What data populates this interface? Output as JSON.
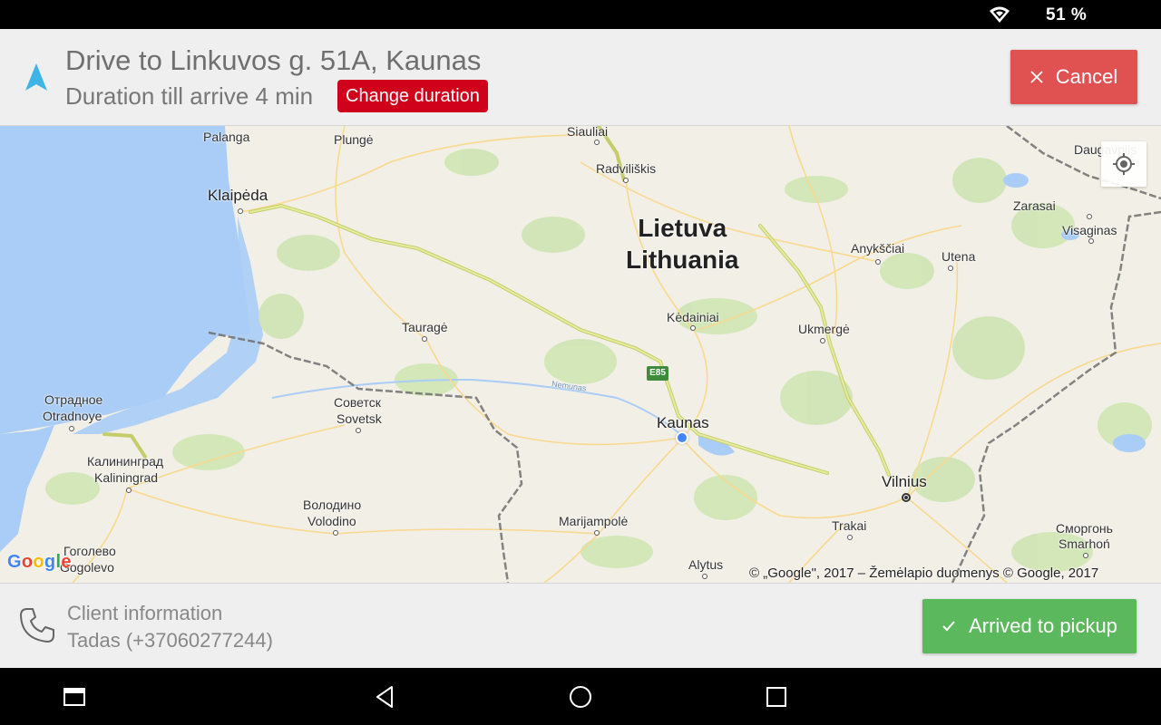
{
  "status_bar": {
    "battery_text": "51 %",
    "wifi_icon": "wifi-icon"
  },
  "header": {
    "nav_icon": "navigation-arrow-icon",
    "destination_title": "Drive to Linkuvos g. 51A, Kaunas",
    "duration_text": "Duration till arrive 4 min",
    "change_duration_label": "Change duration",
    "cancel_label": "Cancel",
    "cancel_icon": "close-icon"
  },
  "map": {
    "country_label_local": "Lietuva",
    "country_label_en": "Lithuania",
    "places": {
      "palanga": "Palanga",
      "plunge": "Plungė",
      "siauliai": "Siauliai",
      "radviliskis": "Radviliškis",
      "daugavpils": "Daugavpils",
      "klaipeda": "Klaipėda",
      "zarasai": "Zarasai",
      "visaginas": "Visaginas",
      "anyksciai": "Anykščiai",
      "utena": "Utena",
      "kedainiai": "Kėdainiai",
      "taurage": "Tauragė",
      "ukmerge": "Ukmergė",
      "otradnoe_ru": "Отрадное",
      "otradnoye": "Otradnoye",
      "sovetsk_ru": "Советск",
      "sovetsk": "Sovetsk",
      "neman_river": "Nemunas",
      "kaunas": "Kaunas",
      "kaliningrad_ru": "Калининград",
      "kaliningrad": "Kaliningrad",
      "vilnius": "Vilnius",
      "volodino_ru": "Володино",
      "volodino": "Volodino",
      "marijampole": "Marijampolė",
      "trakai": "Trakai",
      "smorgon_ru": "Сморгонь",
      "smarhon": "Smarhoń",
      "gogolevo_ru": "Гоголево",
      "gogolevo": "Gogolevo",
      "alytus": "Alytus"
    },
    "road_shield": "E85",
    "google_logo": [
      "G",
      "o",
      "o",
      "g",
      "l",
      "e"
    ],
    "attribution": "© „Google\", 2017 – Žemėlapio duomenys © Google, 2017",
    "locate_icon": "my-location-icon",
    "colors": {
      "water": "#a9cdf6",
      "land": "#f2efe6",
      "park": "#cfe5b4",
      "highway": "#d7e08c",
      "border": "#6e6e6e",
      "current_location": "#4285f4"
    }
  },
  "footer": {
    "phone_icon": "phone-icon",
    "client_label": "Client information",
    "client_name": "Tadas (+37060277244)",
    "arrived_label": "Arrived to pickup",
    "check_icon": "check-icon"
  },
  "nav_bar": {
    "recents_icon": "recent-apps-icon",
    "back_icon": "back-icon",
    "home_icon": "home-icon",
    "overview_icon": "overview-square-icon"
  },
  "theme": {
    "cancel_color": "#e05252",
    "change_duration_color": "#d0021b",
    "arrived_color": "#5cb85c",
    "nav_arrow_color": "#3db4e5"
  }
}
